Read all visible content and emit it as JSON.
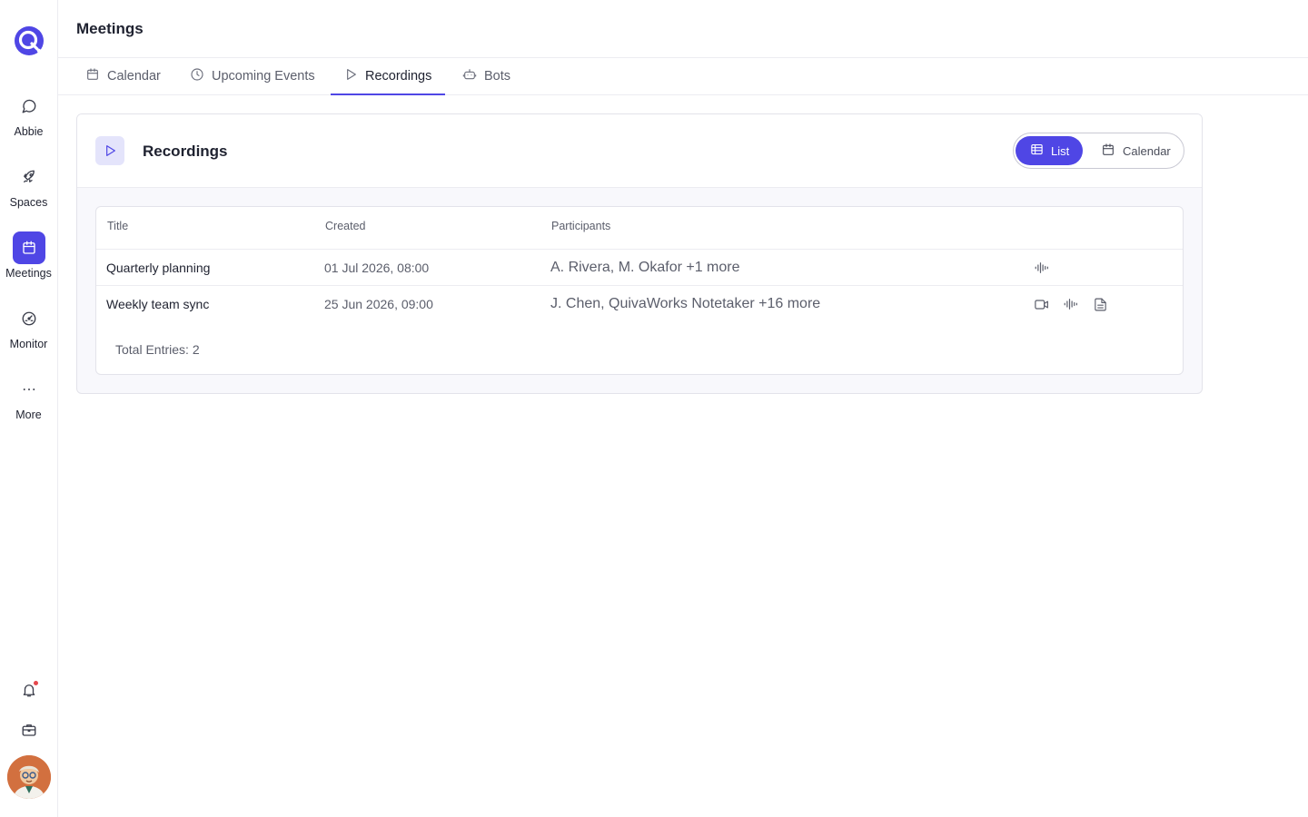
{
  "sidebar": {
    "items": [
      {
        "label": "Abbie",
        "icon": "chat-bubble-icon"
      },
      {
        "label": "Spaces",
        "icon": "rocket-icon"
      },
      {
        "label": "Meetings",
        "icon": "calendar-icon",
        "active": true
      },
      {
        "label": "Monitor",
        "icon": "gauge-icon"
      },
      {
        "label": "More",
        "icon": "ellipsis-icon"
      }
    ],
    "bottom_icons": [
      "bell-icon",
      "briefcase-icon"
    ]
  },
  "header": {
    "title": "Meetings"
  },
  "tabs": [
    {
      "label": "Calendar",
      "icon": "calendar-icon"
    },
    {
      "label": "Upcoming Events",
      "icon": "clock-icon"
    },
    {
      "label": "Recordings",
      "icon": "play-icon",
      "active": true
    },
    {
      "label": "Bots",
      "icon": "robot-icon"
    }
  ],
  "card": {
    "title": "Recordings",
    "view_toggle": {
      "list_label": "List",
      "calendar_label": "Calendar",
      "selected": "List"
    }
  },
  "table": {
    "columns": [
      "Title",
      "Created",
      "Participants"
    ],
    "rows": [
      {
        "title": "Quarterly planning",
        "created": "01 Jul 2026, 08:00",
        "participants": "A. Rivera, M. Okafor +1 more",
        "media": [
          "audio-waveform-icon"
        ]
      },
      {
        "title": "Weekly team sync",
        "created": "25 Jun 2026, 09:00",
        "participants": "J. Chen, QuivaWorks Notetaker +16 more",
        "media": [
          "video-camera-icon",
          "audio-waveform-icon",
          "transcript-document-icon"
        ]
      }
    ],
    "total_entries": "Total Entries: 2"
  },
  "colors": {
    "accent": "#4f46e5",
    "accent_light": "#e4e4fb",
    "notification": "#e5484d"
  }
}
